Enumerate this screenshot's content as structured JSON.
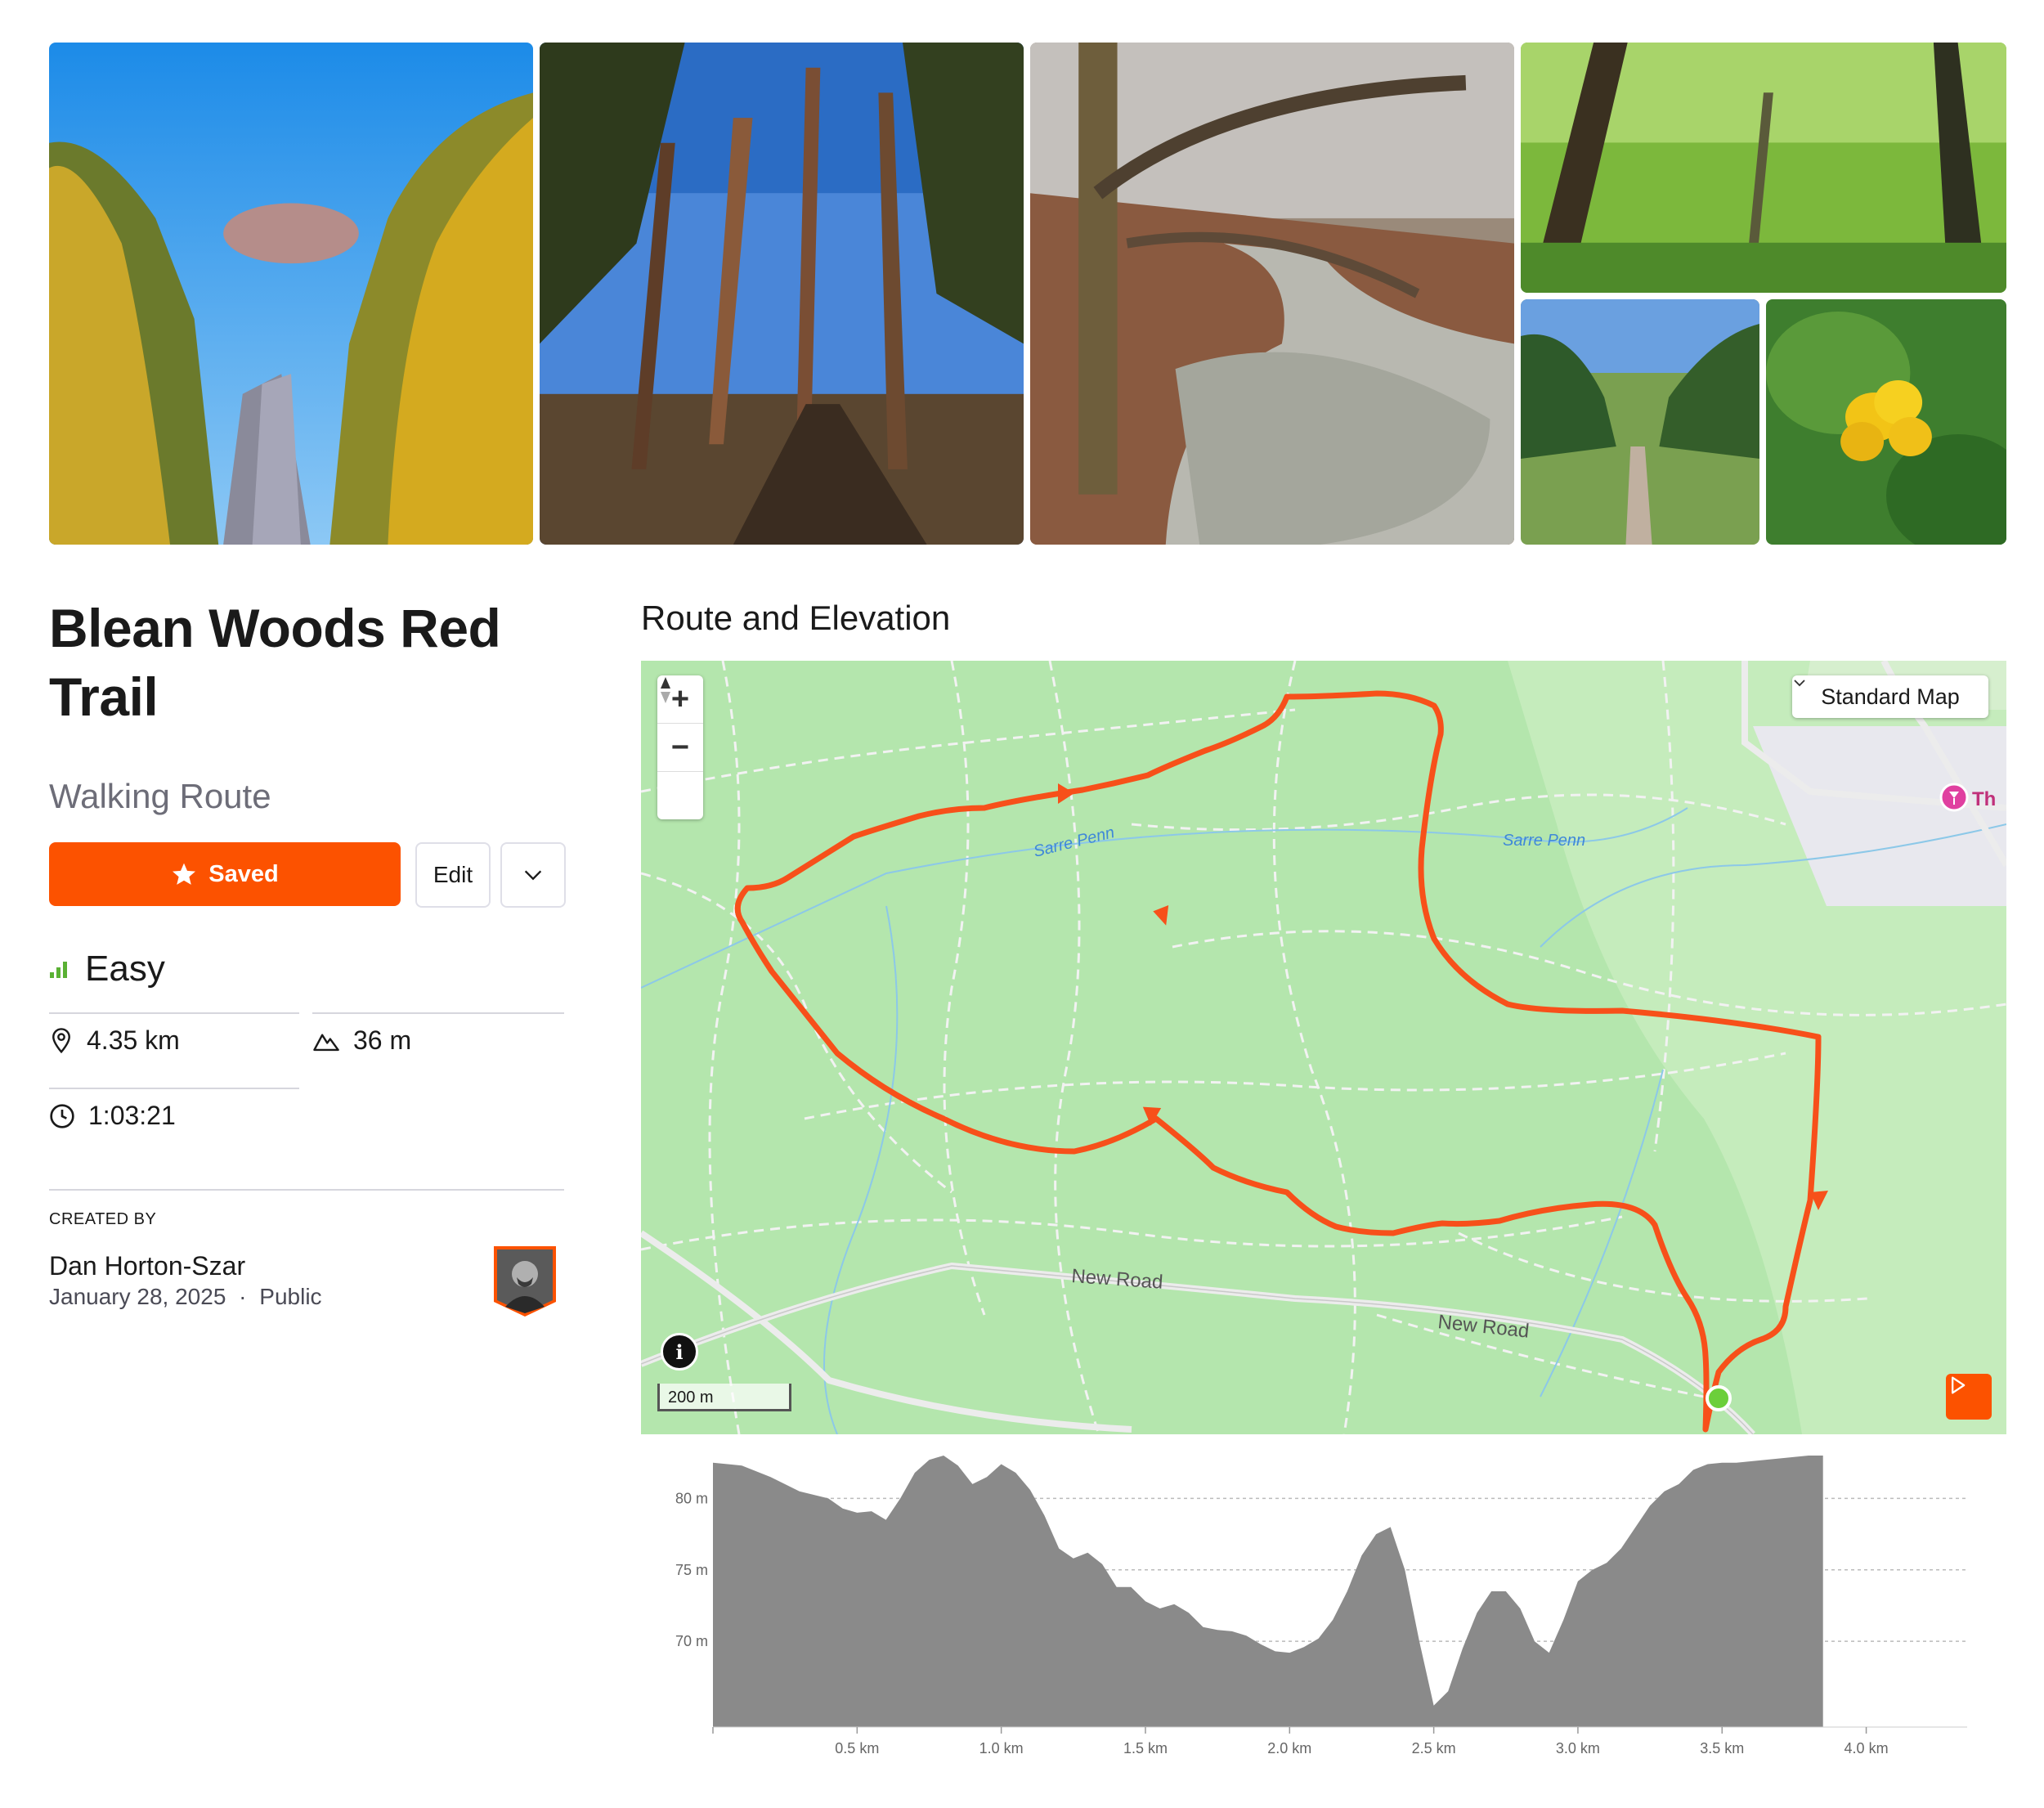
{
  "route": {
    "title": "Blean Woods Red Trail",
    "type": "Walking Route",
    "difficulty": "Easy",
    "distance": "4.35 km",
    "elevation_gain": "36 m",
    "time": "1:03:21"
  },
  "actions": {
    "saved_label": "Saved",
    "edit_label": "Edit"
  },
  "creator": {
    "label": "CREATED BY",
    "name": "Dan Horton-Szar",
    "date": "January 28, 2025",
    "visibility": "Public",
    "separator": "·"
  },
  "section": {
    "title": "Route and Elevation"
  },
  "map": {
    "type_label": "Standard Map",
    "scale_label": "200 m",
    "labels": {
      "stream_1": "Sarre Penn",
      "stream_2": "Sarre Penn",
      "road_1": "New Road",
      "road_2": "New Road",
      "poi": "Th"
    },
    "zoom_in": "+",
    "zoom_out": "−"
  },
  "colors": {
    "accent": "#fc5200",
    "route_line": "#f7501a",
    "map_bg": "#b4e6ad",
    "elevation_fill": "#8a8a8a",
    "difficulty_green": "#5ab134"
  },
  "chart_data": {
    "type": "area",
    "xlabel": "",
    "ylabel": "",
    "x_unit": "km",
    "y_unit": "m",
    "xlim": [
      0,
      4.35
    ],
    "ylim": [
      64,
      83
    ],
    "x_ticks": [
      "0.5 km",
      "1.0 km",
      "1.5 km",
      "2.0 km",
      "2.5 km",
      "3.0 km",
      "3.5 km",
      "4.0 km"
    ],
    "x_tick_values": [
      0.5,
      1.0,
      1.5,
      2.0,
      2.5,
      3.0,
      3.5,
      4.0
    ],
    "y_ticks": [
      "70 m",
      "75 m",
      "80 m"
    ],
    "y_tick_values": [
      70,
      75,
      80
    ],
    "grid": "horizontal dashed",
    "x": [
      0,
      0.1,
      0.2,
      0.3,
      0.4,
      0.45,
      0.5,
      0.55,
      0.6,
      0.65,
      0.7,
      0.75,
      0.8,
      0.85,
      0.9,
      0.95,
      1.0,
      1.05,
      1.1,
      1.15,
      1.2,
      1.25,
      1.3,
      1.35,
      1.4,
      1.45,
      1.5,
      1.55,
      1.6,
      1.65,
      1.7,
      1.75,
      1.8,
      1.85,
      1.9,
      1.95,
      2.0,
      2.05,
      2.1,
      2.15,
      2.2,
      2.25,
      2.3,
      2.35,
      2.4,
      2.45,
      2.5,
      2.55,
      2.6,
      2.65,
      2.7,
      2.75,
      2.8,
      2.85,
      2.9,
      2.95,
      3.0,
      3.05,
      3.1,
      3.15,
      3.2,
      3.25,
      3.3,
      3.35,
      3.4,
      3.45,
      3.5,
      3.55,
      3.6,
      3.65,
      3.7,
      3.75,
      3.8,
      3.85,
      3.9,
      3.95,
      4.0,
      4.05,
      4.1,
      4.15,
      4.2,
      4.25,
      4.3,
      4.35
    ],
    "series": [
      {
        "values": [
          82.5,
          82.3,
          81.5,
          80.5,
          80.0,
          79.3,
          79.0,
          79.1,
          78.5,
          80.0,
          81.8,
          82.7,
          83.0,
          82.3,
          81.0,
          81.5,
          82.4,
          81.8,
          80.6,
          78.8,
          76.5,
          75.8,
          76.2,
          75.4,
          73.8,
          73.8,
          72.8,
          72.3,
          72.6,
          72.0,
          71.0,
          70.8,
          70.7,
          70.4,
          69.8,
          69.3,
          69.2,
          69.6,
          70.2,
          71.5,
          73.5,
          76.0,
          77.5,
          78.0,
          75.0,
          70.0,
          65.5,
          66.5,
          69.5,
          72.0,
          73.5,
          73.5,
          72.3,
          70.0,
          69.2,
          71.5,
          74.2,
          75.0,
          75.5,
          76.5,
          78.0,
          79.5,
          80.5,
          81.0,
          82.0,
          82.4,
          82.5,
          82.5,
          82.6,
          82.7,
          82.8,
          82.9,
          83.0,
          83.0
        ]
      }
    ]
  }
}
